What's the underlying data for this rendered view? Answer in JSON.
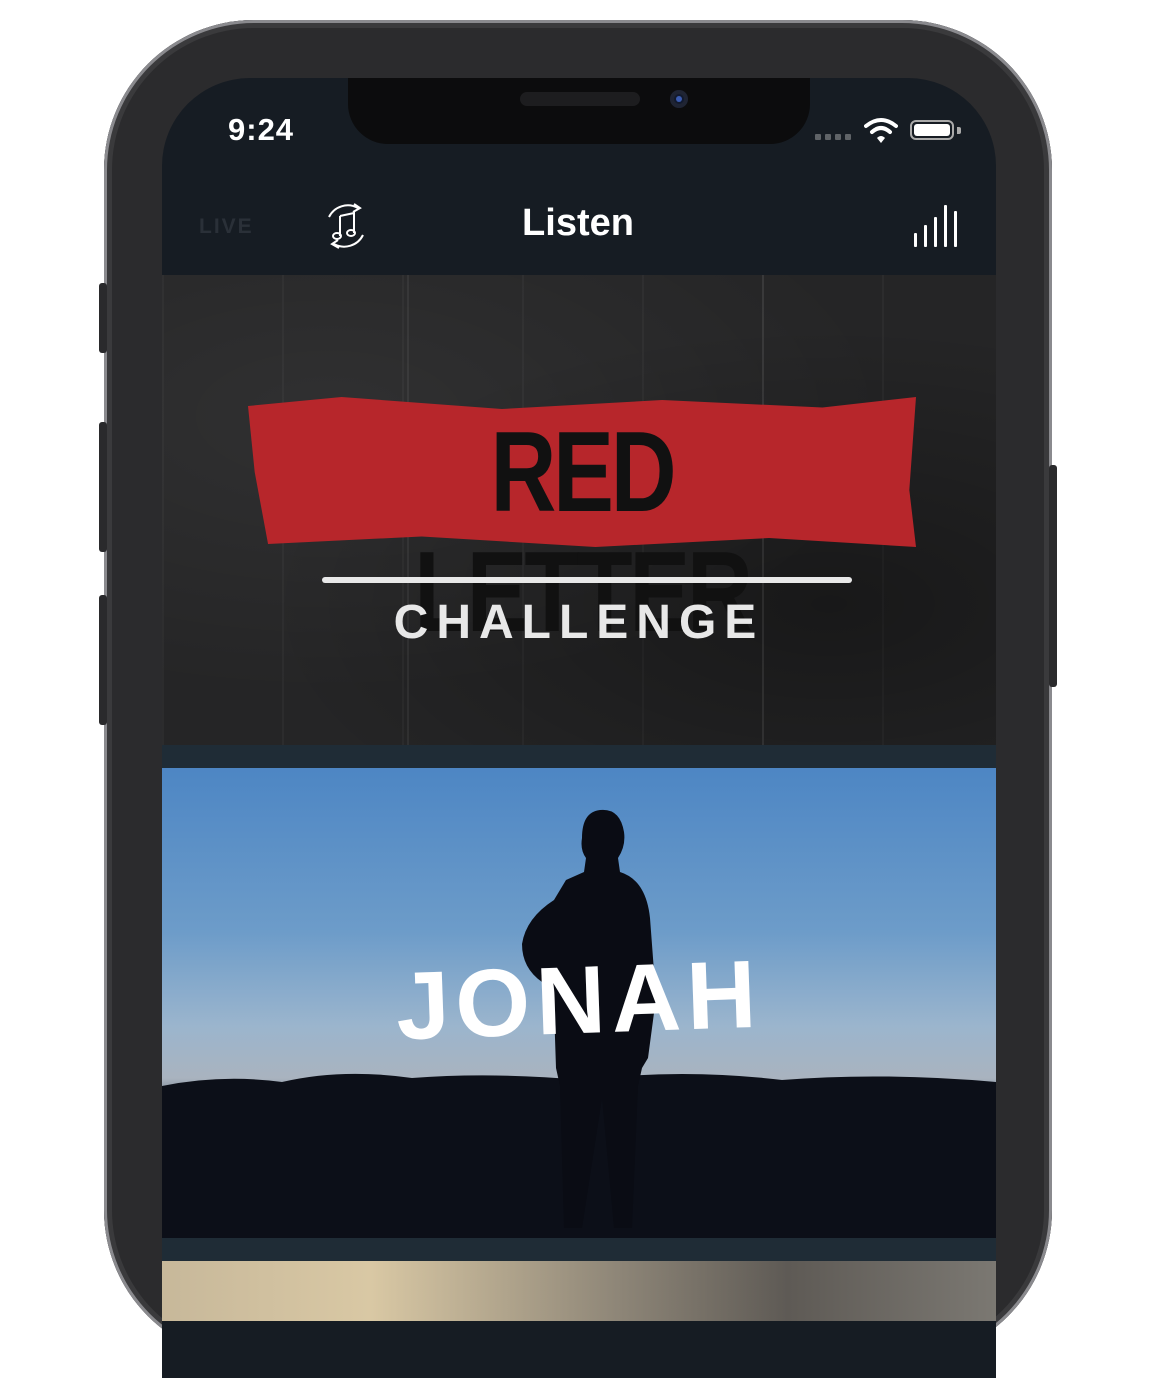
{
  "status_bar": {
    "time": "9:24"
  },
  "nav": {
    "live_label": "LIVE",
    "title": "Listen"
  },
  "cards": [
    {
      "id": "red-letter",
      "title": "RED LETTER",
      "subtitle": "CHALLENGE",
      "accent_color": "#b7262b"
    },
    {
      "id": "jonah",
      "title": "JONAH"
    },
    {
      "id": "next"
    }
  ],
  "icons": [
    "music-note-refresh-icon",
    "equalizer-icon",
    "wifi-icon",
    "battery-icon",
    "signal-icon"
  ]
}
